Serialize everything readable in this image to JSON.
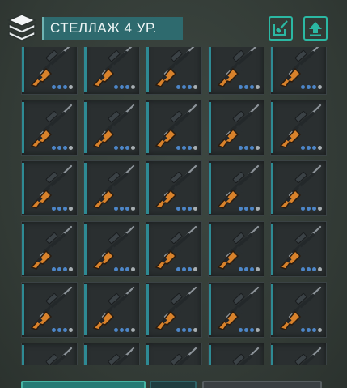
{
  "storage": {
    "title": "СТЕЛЛАЖ 4 УР.",
    "box_icon": "stacked-boxes-icon",
    "sort_icon": "sort-broom-icon",
    "upload_icon": "upload-arrow-icon"
  },
  "inventory": {
    "item_icon": "rifle-icon",
    "columns": 5,
    "visible_rows": 6,
    "quality_dots": {
      "filled": 3,
      "total": 4
    }
  },
  "footer": {
    "buttons": [
      "teal-action-button",
      "dark-teal-button",
      "grey-button"
    ]
  },
  "colors": {
    "accent": "#2bb8a3",
    "title_bg": "#2e6a6e",
    "slot_bg": "#2a2f30",
    "slot_edge": "#2e8a93",
    "stock_orange": "#d9822b",
    "dot_blue": "#4d86c8",
    "dot_grey": "#a7aeb2"
  }
}
